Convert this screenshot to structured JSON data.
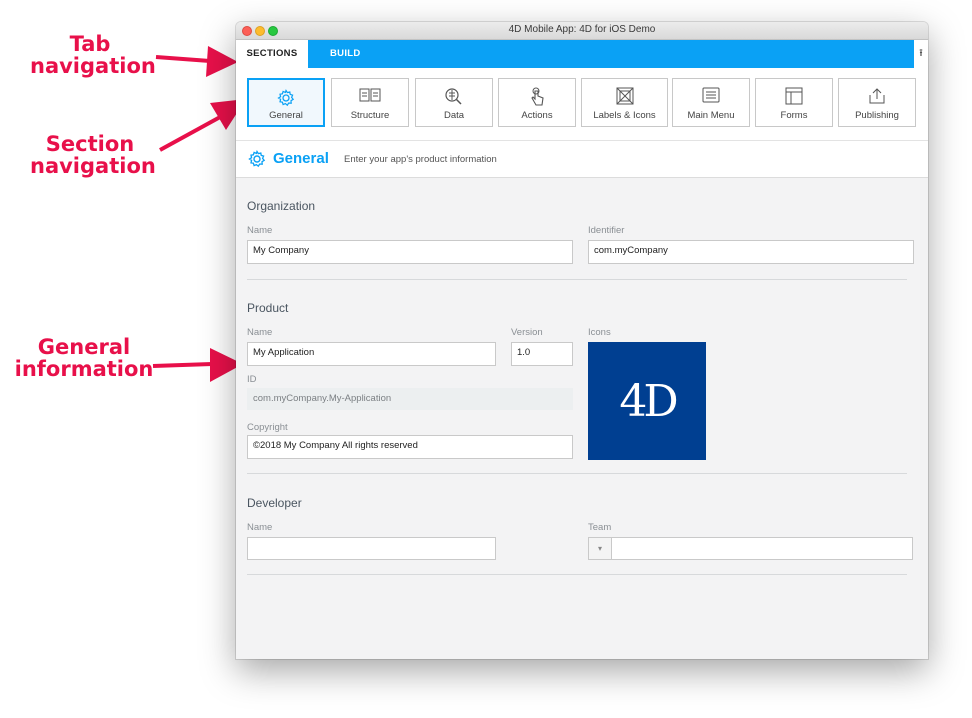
{
  "annotations": {
    "tab_navigation": [
      "Tab",
      "navigation"
    ],
    "section_navigation": [
      "Section",
      "navigation"
    ],
    "general_information": [
      "General",
      "information"
    ]
  },
  "window": {
    "title": "4D Mobile App: 4D for iOS Demo"
  },
  "tabs": {
    "sections": "SECTIONS",
    "build": "BUILD",
    "export_icon": "upload-icon"
  },
  "sections": [
    {
      "label": "General",
      "icon": "gear-icon",
      "active": true
    },
    {
      "label": "Structure",
      "icon": "structure-icon"
    },
    {
      "label": "Data",
      "icon": "data-search-icon"
    },
    {
      "label": "Actions",
      "icon": "tap-hand-icon"
    },
    {
      "label": "Labels & Icons",
      "icon": "labels-icons-icon"
    },
    {
      "label": "Main Menu",
      "icon": "menu-icon"
    },
    {
      "label": "Forms",
      "icon": "forms-icon"
    },
    {
      "label": "Publishing",
      "icon": "publish-icon"
    }
  ],
  "page": {
    "title": "General",
    "subtitle": "Enter your app's product information"
  },
  "organization": {
    "heading": "Organization",
    "name_label": "Name",
    "name_value": "My Company",
    "identifier_label": "Identifier",
    "identifier_value": "com.myCompany"
  },
  "product": {
    "heading": "Product",
    "name_label": "Name",
    "name_value": "My Application",
    "version_label": "Version",
    "version_value": "1.0",
    "icons_label": "Icons",
    "icon_text": "4D",
    "id_label": "ID",
    "id_value": "com.myCompany.My-Application",
    "copyright_label": "Copyright",
    "copyright_value": "©2018 My Company All rights reserved"
  },
  "developer": {
    "heading": "Developer",
    "name_label": "Name",
    "name_value": "",
    "team_label": "Team",
    "team_value": ""
  },
  "colors": {
    "accent": "#0aa1f5",
    "annotation": "#e8104a",
    "logo_bg": "#003f91"
  }
}
